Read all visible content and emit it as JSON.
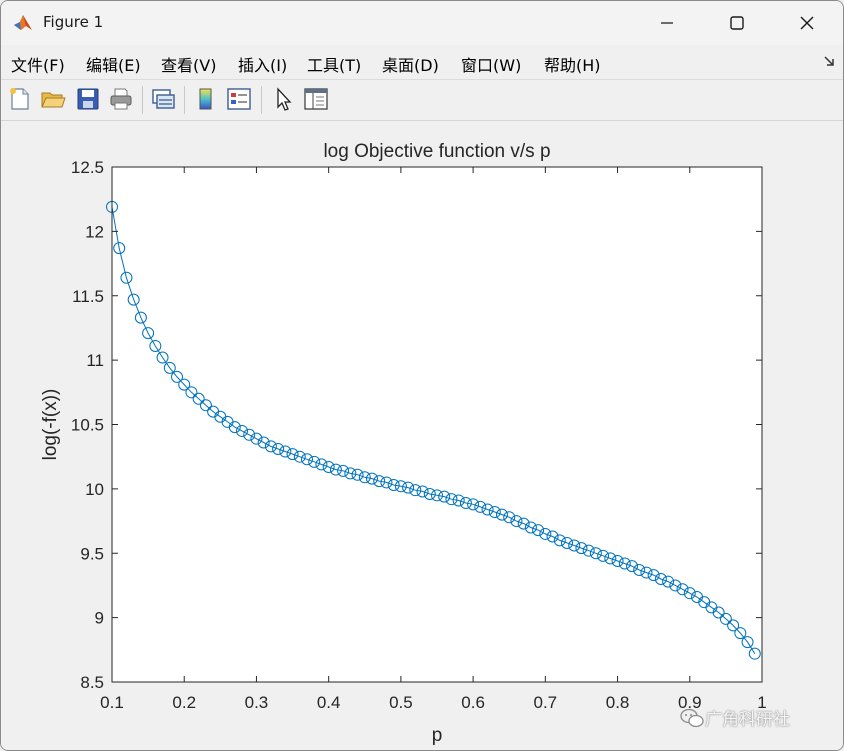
{
  "window": {
    "title": "Figure 1"
  },
  "menu": {
    "items": [
      {
        "label": "文件(F)"
      },
      {
        "label": "编辑(E)"
      },
      {
        "label": "查看(V)"
      },
      {
        "label": "插入(I)"
      },
      {
        "label": "工具(T)"
      },
      {
        "label": "桌面(D)"
      },
      {
        "label": "窗口(W)"
      },
      {
        "label": "帮助(H)"
      }
    ]
  },
  "toolbar": {
    "buttons": [
      "new-figure-icon",
      "open-file-icon",
      "save-icon",
      "print-icon",
      "link-plot-icon",
      "colorbar-icon",
      "legend-icon",
      "pointer-icon",
      "property-inspector-icon"
    ]
  },
  "watermark": {
    "text": "广角科研社"
  },
  "colors": {
    "line": "#0072bd",
    "axes_bg": "#ffffff",
    "figure_bg": "#f0f0f0"
  },
  "chart_data": {
    "type": "line",
    "title": "log Objective function v/s p",
    "xlabel": "p",
    "ylabel": "log(-f(x))",
    "xlim": [
      0.1,
      1
    ],
    "ylim": [
      8.5,
      12.5
    ],
    "xticks": [
      "0.1",
      "0.2",
      "0.3",
      "0.4",
      "0.5",
      "0.6",
      "0.7",
      "0.8",
      "0.9",
      "1"
    ],
    "yticks": [
      "8.5",
      "9",
      "9.5",
      "10",
      "10.5",
      "11",
      "11.5",
      "12",
      "12.5"
    ],
    "marker": "circle",
    "grid": false,
    "series": [
      {
        "x": [
          0.1,
          0.11,
          0.12,
          0.13,
          0.14,
          0.15,
          0.16,
          0.17,
          0.18,
          0.19,
          0.2,
          0.21,
          0.22,
          0.23,
          0.24,
          0.25,
          0.26,
          0.27,
          0.28,
          0.29,
          0.3,
          0.31,
          0.32,
          0.33,
          0.34,
          0.35,
          0.36,
          0.37,
          0.38,
          0.39,
          0.4,
          0.41,
          0.42,
          0.43,
          0.44,
          0.45,
          0.46,
          0.47,
          0.48,
          0.49,
          0.5,
          0.51,
          0.52,
          0.53,
          0.54,
          0.55,
          0.56,
          0.57,
          0.58,
          0.59,
          0.6,
          0.61,
          0.62,
          0.63,
          0.64,
          0.65,
          0.66,
          0.67,
          0.68,
          0.69,
          0.7,
          0.71,
          0.72,
          0.73,
          0.74,
          0.75,
          0.76,
          0.77,
          0.78,
          0.79,
          0.8,
          0.81,
          0.82,
          0.83,
          0.84,
          0.85,
          0.86,
          0.87,
          0.88,
          0.89,
          0.9,
          0.91,
          0.92,
          0.93,
          0.94,
          0.95,
          0.96,
          0.97,
          0.98,
          0.99
        ],
        "y": [
          12.19,
          11.87,
          11.64,
          11.47,
          11.33,
          11.21,
          11.11,
          11.02,
          10.94,
          10.87,
          10.81,
          10.75,
          10.7,
          10.65,
          10.6,
          10.56,
          10.52,
          10.48,
          10.45,
          10.42,
          10.39,
          10.36,
          10.33,
          10.31,
          10.29,
          10.27,
          10.25,
          10.23,
          10.21,
          10.19,
          10.17,
          10.15,
          10.14,
          10.12,
          10.11,
          10.09,
          10.08,
          10.06,
          10.05,
          10.03,
          10.02,
          10.01,
          9.99,
          9.98,
          9.96,
          9.95,
          9.94,
          9.92,
          9.91,
          9.89,
          9.88,
          9.86,
          9.84,
          9.82,
          9.8,
          9.78,
          9.75,
          9.73,
          9.7,
          9.68,
          9.65,
          9.63,
          9.6,
          9.58,
          9.56,
          9.54,
          9.52,
          9.5,
          9.48,
          9.46,
          9.44,
          9.42,
          9.4,
          9.37,
          9.35,
          9.33,
          9.3,
          9.28,
          9.25,
          9.22,
          9.19,
          9.16,
          9.12,
          9.08,
          9.04,
          8.99,
          8.94,
          8.88,
          8.81,
          8.72
        ]
      }
    ]
  }
}
